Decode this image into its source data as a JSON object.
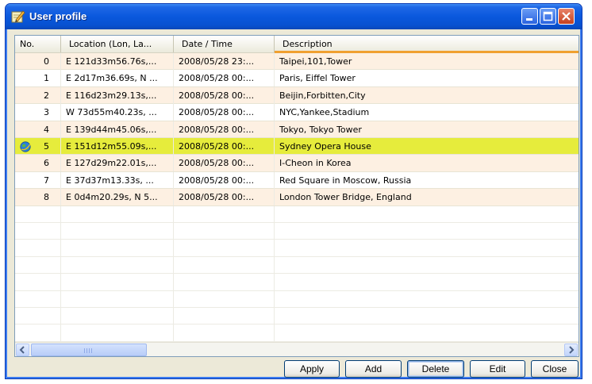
{
  "window": {
    "title": "User profile",
    "app_icon": "pencil-note-icon"
  },
  "table": {
    "columns": [
      "No.",
      "Location (Lon, La...",
      "Date / Time",
      "Description"
    ],
    "rows": [
      {
        "no": "0",
        "location": "E 121d33m56.76s,...",
        "datetime": "2008/05/28 23:...",
        "description": "Taipei,101,Tower"
      },
      {
        "no": "1",
        "location": "E 2d17m36.69s, N ...",
        "datetime": "2008/05/28 00:...",
        "description": "Paris, Eiffel Tower"
      },
      {
        "no": "2",
        "location": "E 116d23m29.13s,...",
        "datetime": "2008/05/28 00:...",
        "description": "Beijin,Forbitten,City"
      },
      {
        "no": "3",
        "location": "W 73d55m40.23s, ...",
        "datetime": "2008/05/28 00:...",
        "description": "NYC,Yankee,Stadium"
      },
      {
        "no": "4",
        "location": "E 139d44m45.06s,...",
        "datetime": "2008/05/28 00:...",
        "description": "Tokyo, Tokyo Tower"
      },
      {
        "no": "5",
        "location": "E 151d12m55.09s,...",
        "datetime": "2008/05/28 00:...",
        "description": "Sydney Opera House"
      },
      {
        "no": "6",
        "location": "E 127d29m22.01s,...",
        "datetime": "2008/05/28 00:...",
        "description": "I-Cheon in Korea"
      },
      {
        "no": "7",
        "location": "E 37d37m13.33s, ...",
        "datetime": "2008/05/28 00:...",
        "description": "Red Square in Moscow, Russia"
      },
      {
        "no": "8",
        "location": "E 0d4m20.29s, N 5...",
        "datetime": "2008/05/28 00:...",
        "description": "London Tower Bridge, England"
      }
    ],
    "selected_index": 5,
    "selected_row_icon": "globe-icon"
  },
  "colors": {
    "selected_row": "#e6ec3c",
    "alt_row": "#fdf0e2",
    "title_bar": "#0a58dd"
  },
  "buttons": {
    "apply": "Apply",
    "add": "Add",
    "delete": "Delete",
    "edit": "Edit",
    "close": "Close"
  }
}
